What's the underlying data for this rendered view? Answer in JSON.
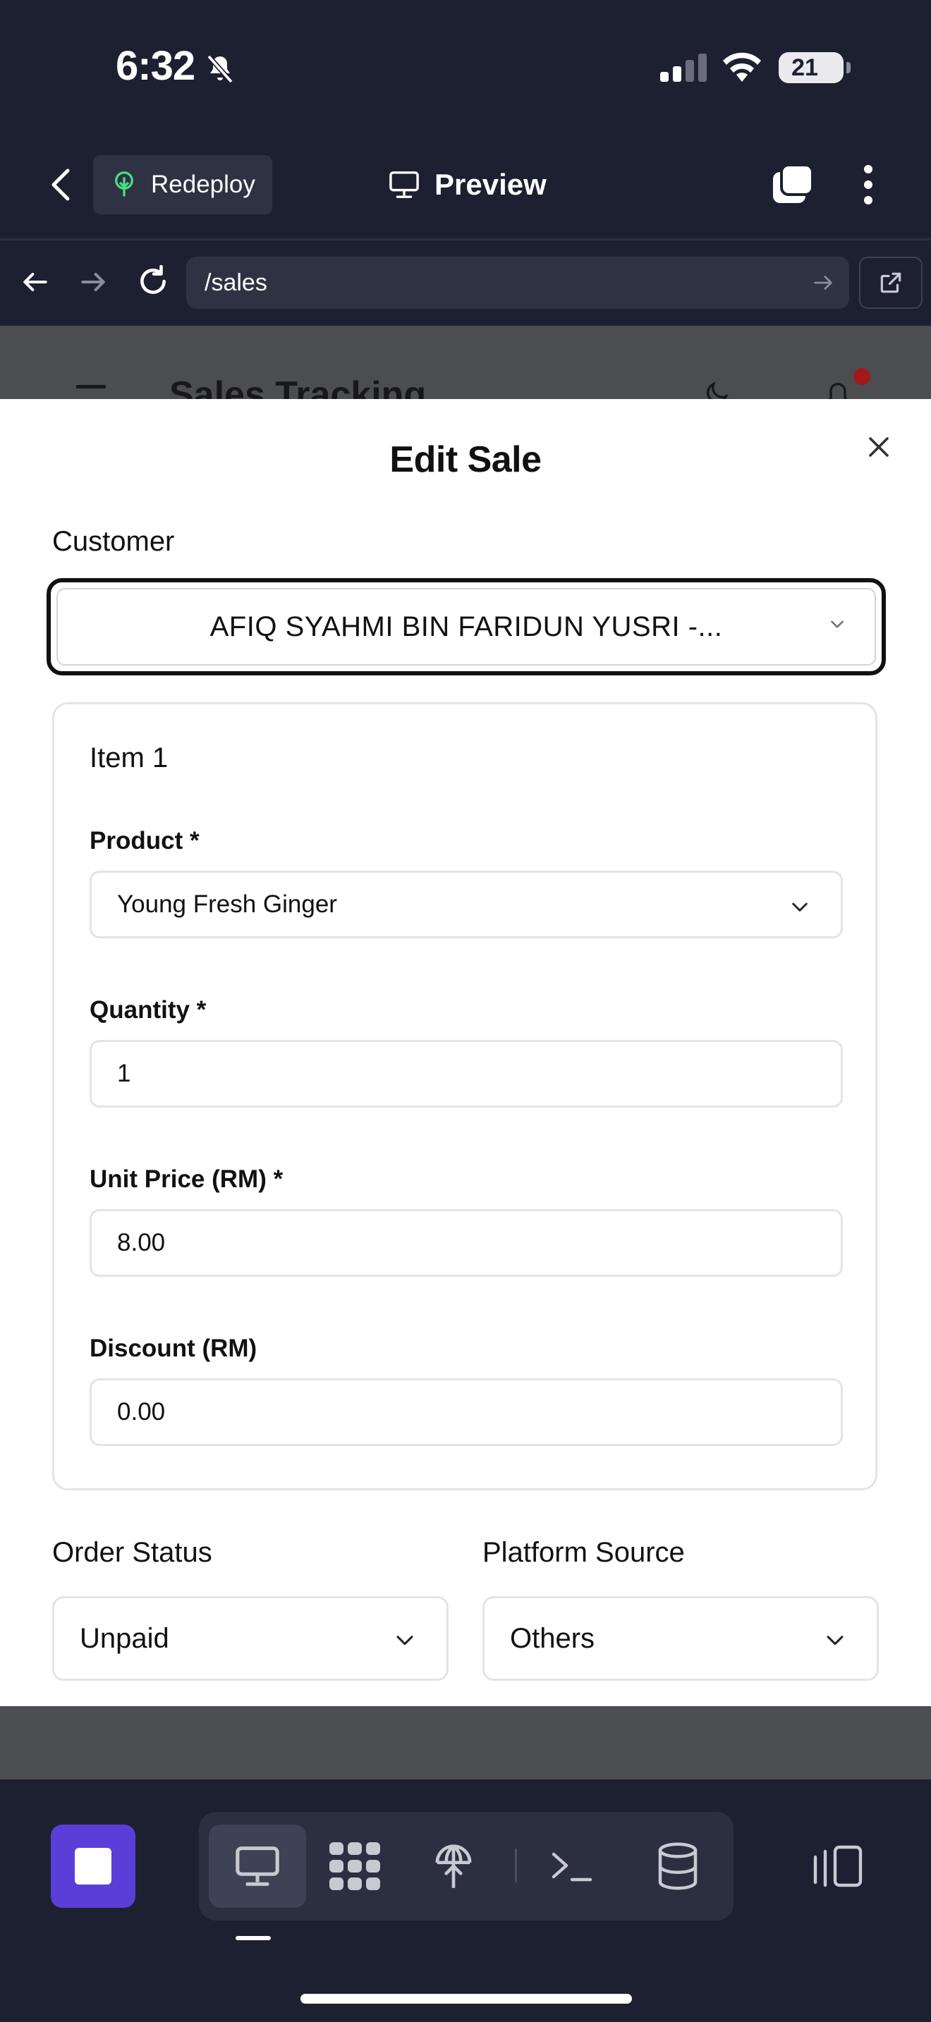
{
  "status_bar": {
    "time": "6:32",
    "battery": "21"
  },
  "top_bar": {
    "redeploy_label": "Redeploy",
    "preview_label": "Preview"
  },
  "address_bar": {
    "url": "/sales"
  },
  "app_background": {
    "title": "Sales Tracking"
  },
  "modal": {
    "title": "Edit Sale",
    "customer": {
      "label": "Customer",
      "value": "AFIQ SYAHMI BIN FARIDUN YUSRI -..."
    },
    "item": {
      "title": "Item 1",
      "product_label": "Product *",
      "product_value": "Young Fresh Ginger",
      "quantity_label": "Quantity *",
      "quantity_value": "1",
      "unit_price_label": "Unit Price (RM) *",
      "unit_price_value": "8.00",
      "discount_label": "Discount (RM)",
      "discount_value": "0.00"
    },
    "order_status": {
      "label": "Order Status",
      "value": "Unpaid"
    },
    "platform_source": {
      "label": "Platform Source",
      "value": "Others"
    }
  },
  "icons": {
    "status": [
      "bell-slash-icon",
      "cellular-signal-icon",
      "wifi-icon",
      "battery-icon"
    ],
    "top_bar": [
      "back-chevron-icon",
      "deploy-tree-icon",
      "monitor-icon",
      "tabs-icon",
      "more-vertical-icon"
    ],
    "address_bar": [
      "arrow-left-icon",
      "arrow-right-icon",
      "reload-icon",
      "go-arrow-icon",
      "external-link-icon"
    ],
    "toolbar": [
      "stop-icon",
      "monitor-icon",
      "app-grid-icon",
      "deploy-icon",
      "terminal-icon",
      "database-icon",
      "panel-layout-icon"
    ]
  },
  "colors": {
    "chrome_bg": "#1d2030",
    "accent": "#5a3ed8",
    "notification": "#a11a1a"
  }
}
